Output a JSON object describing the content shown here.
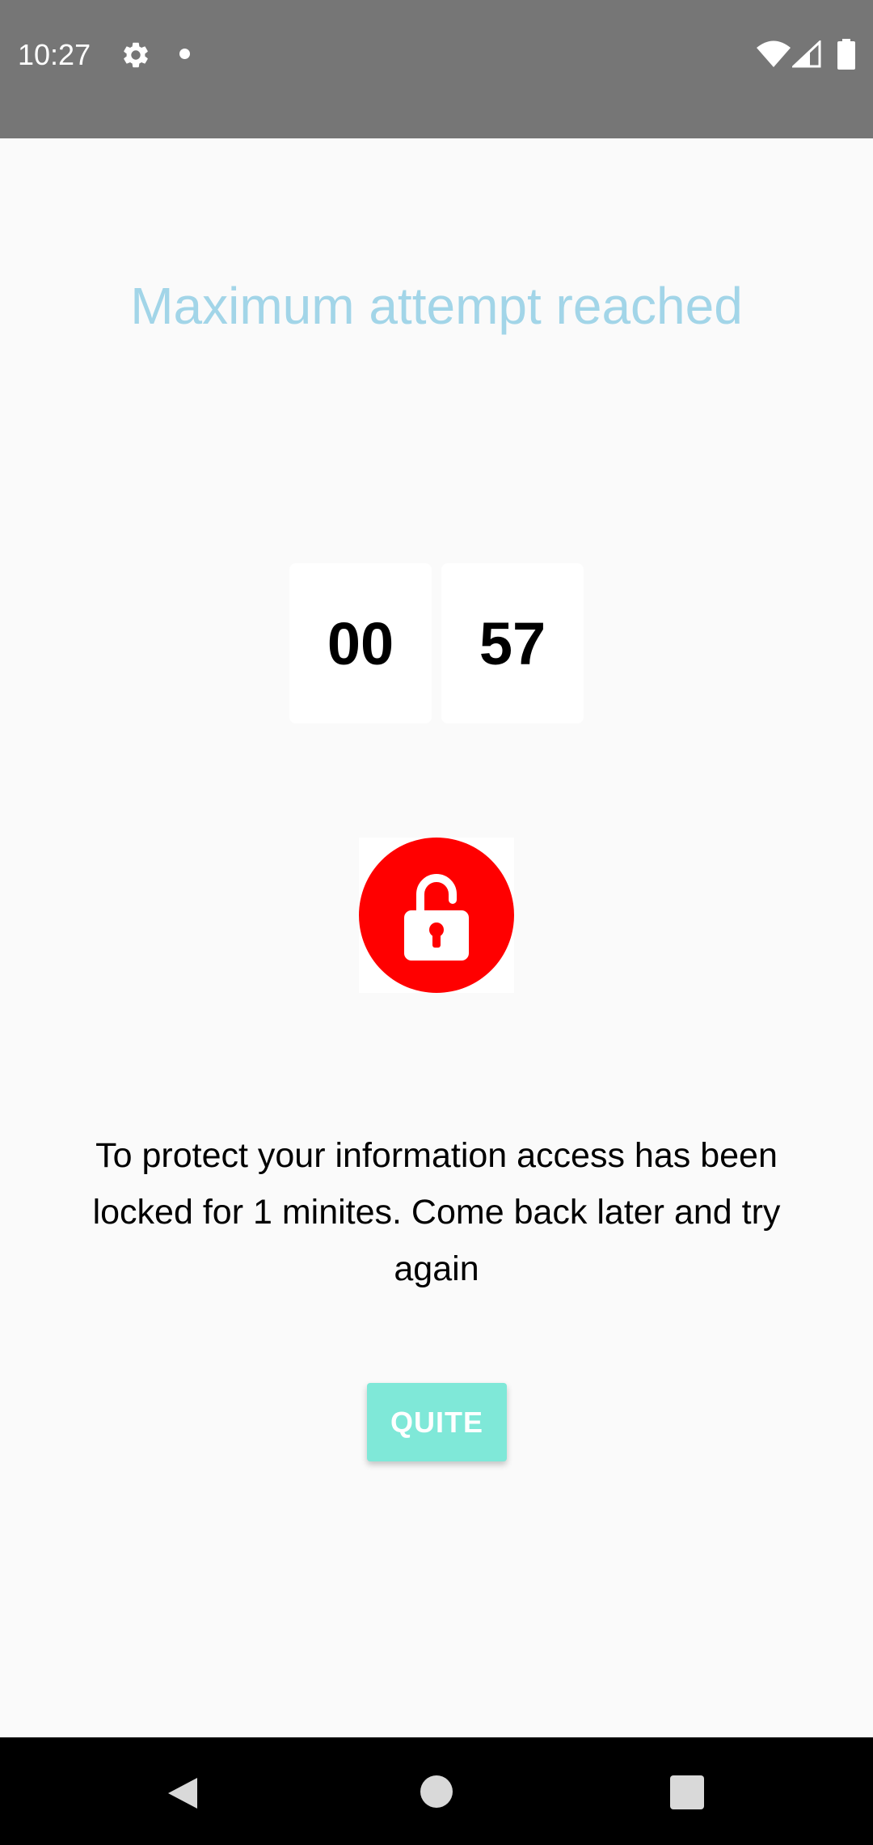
{
  "status_bar": {
    "time": "10:27",
    "icons": [
      "gear-icon",
      "notification-dot-icon",
      "wifi-icon",
      "signal-icon",
      "battery-icon"
    ]
  },
  "screen": {
    "title": "Maximum attempt reached",
    "timer": {
      "minutes": "00",
      "seconds": "57"
    },
    "lock_icon": "lock-icon",
    "message": "To protect your information access has been locked for 1 minites. Come back later and try again",
    "quit_label": "QUITE"
  },
  "nav_bar": {
    "icons": [
      "back-icon",
      "home-icon",
      "recents-icon"
    ]
  },
  "colors": {
    "status_bar": "#767676",
    "background": "#fafafa",
    "title": "#a2d5e8",
    "lock_badge": "#ff0000",
    "button": "#7fe8d8",
    "nav_bar": "#000000"
  }
}
